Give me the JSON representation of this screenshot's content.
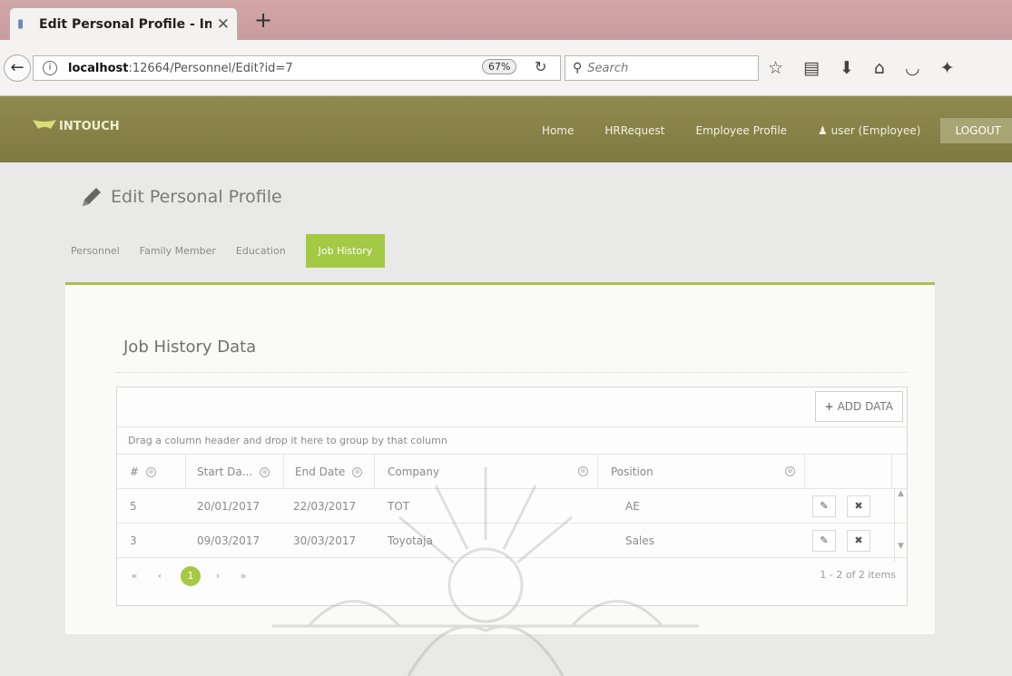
{
  "browser": {
    "tab_title": "Edit Personal Profile - Into...",
    "new_tab": "+",
    "url_host": "localhost",
    "url_path": ":12664/Personnel/Edit?id=7",
    "zoom": "67%",
    "search_placeholder": "Search"
  },
  "header": {
    "brand": "INTOUCH",
    "nav": [
      "Home",
      "HRRequest",
      "Employee Profile"
    ],
    "user": "user (Employee)",
    "logout": "LOGOUT"
  },
  "page": {
    "title": "Edit Personal Profile",
    "tabs": [
      "Personnel",
      "Family Member",
      "Education",
      "Job History"
    ],
    "active_tab": "Job History"
  },
  "job_history": {
    "title": "Job History Data",
    "add_button": "ADD DATA",
    "group_hint": "Drag a column header and drop it here to group by that column",
    "columns": [
      "#",
      "Start Da...",
      "End Date",
      "Company",
      "Position"
    ],
    "rows": [
      {
        "no": "5",
        "start": "20/01/2017",
        "end": "22/03/2017",
        "company": "TOT",
        "position": "AE"
      },
      {
        "no": "3",
        "start": "09/03/2017",
        "end": "30/03/2017",
        "company": "Toyotaja",
        "position": "Sales"
      }
    ],
    "pager": {
      "first": "«",
      "prev": "‹",
      "current": "1",
      "next": "›",
      "last": "»",
      "info": "1 - 2 of 2 items"
    }
  },
  "colors": {
    "header_bg": "#857f46",
    "accent": "#a4c944"
  }
}
